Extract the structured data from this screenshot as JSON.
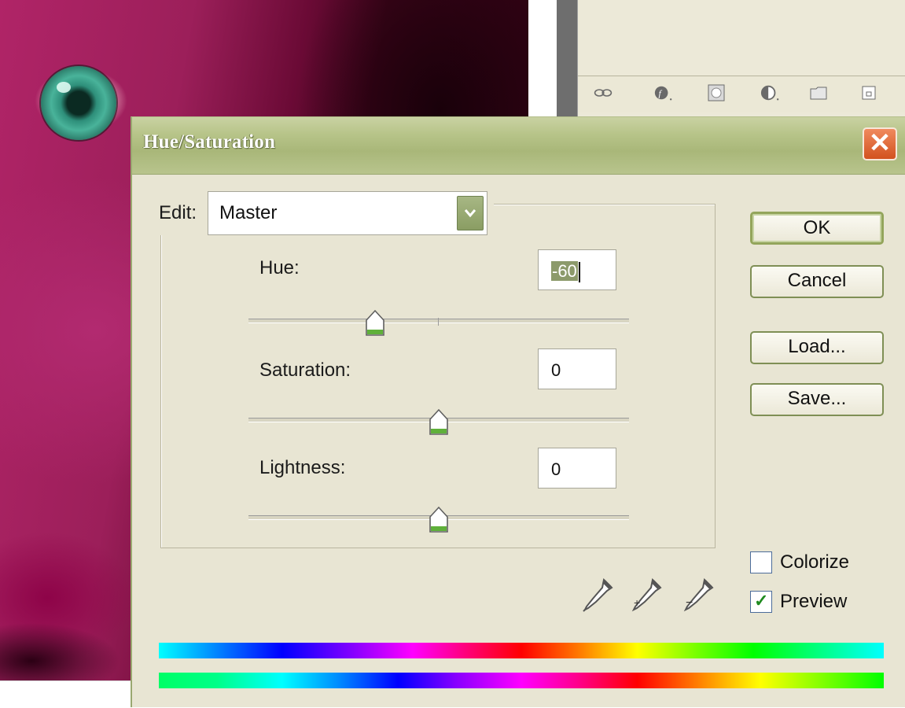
{
  "dialog": {
    "title": "Hue/Saturation",
    "close_glyph": "✕"
  },
  "edit": {
    "label": "Edit:",
    "value": "Master"
  },
  "hue": {
    "label": "Hue:",
    "value": "-60",
    "slider_value": -60,
    "range": [
      -180,
      180
    ]
  },
  "saturation": {
    "label": "Saturation:",
    "value": "0",
    "slider_value": 0,
    "range": [
      -100,
      100
    ]
  },
  "lightness": {
    "label": "Lightness:",
    "value": "0",
    "slider_value": 0,
    "range": [
      -100,
      100
    ]
  },
  "buttons": {
    "ok": "OK",
    "cancel": "Cancel",
    "load": "Load...",
    "save": "Save..."
  },
  "options": {
    "colorize": {
      "label": "Colorize",
      "checked": false
    },
    "preview": {
      "label": "Preview",
      "checked": true
    }
  },
  "icons": {
    "layers_toolbar": [
      "link-icon",
      "layer-style-icon",
      "layer-mask-icon",
      "adjustment-layer-icon",
      "folder-icon",
      "new-layer-icon"
    ],
    "eyedroppers": [
      "eyedropper-icon",
      "eyedropper-plus-icon",
      "eyedropper-minus-icon"
    ]
  },
  "colors": {
    "dialog_bg": "#e8e5d3",
    "titlebar": "#b7c489",
    "accent_green": "#8c9a6b",
    "close_red": "#d2521f"
  }
}
